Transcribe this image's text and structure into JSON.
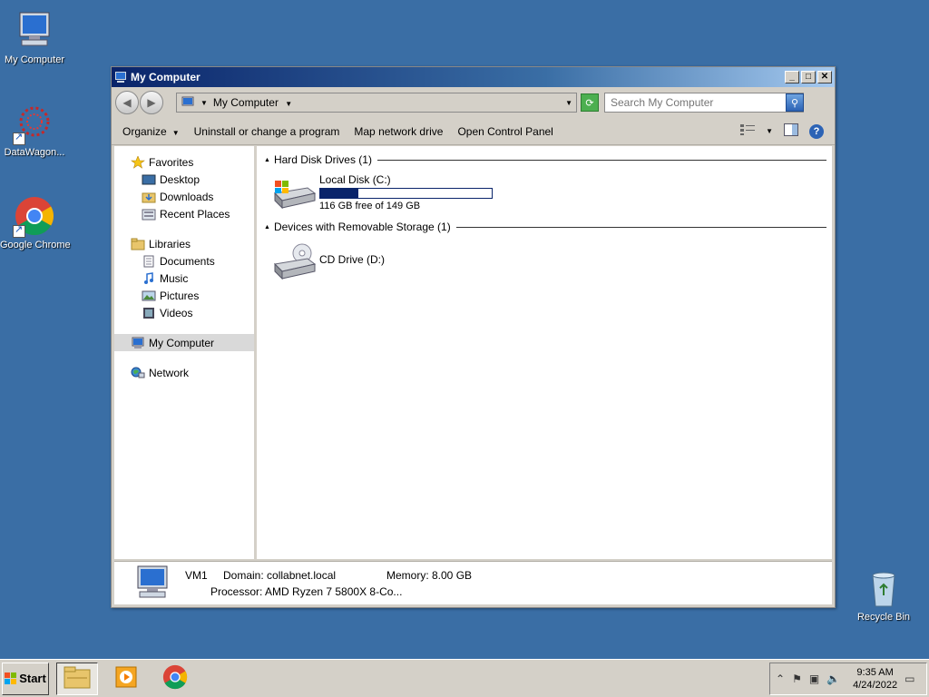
{
  "desktop": {
    "icons": [
      {
        "label": "My Computer"
      },
      {
        "label": "DataWagon..."
      },
      {
        "label": "Google Chrome"
      },
      {
        "label": "Recycle Bin"
      }
    ]
  },
  "window": {
    "title": "My Computer",
    "address": {
      "path": "My Computer"
    },
    "search": {
      "placeholder": "Search My Computer"
    },
    "toolbar": {
      "organize": "Organize",
      "uninstall": "Uninstall or change a program",
      "map_drive": "Map network drive",
      "control_panel": "Open Control Panel"
    },
    "nav": {
      "favorites": {
        "label": "Favorites",
        "items": [
          "Desktop",
          "Downloads",
          "Recent Places"
        ]
      },
      "libraries": {
        "label": "Libraries",
        "items": [
          "Documents",
          "Music",
          "Pictures",
          "Videos"
        ]
      },
      "computer": "My Computer",
      "network": "Network"
    },
    "groups": {
      "hdd": {
        "header": "Hard Disk Drives (1)",
        "drive_name": "Local Disk (C:)",
        "free_text": "116 GB free of 149 GB",
        "used_fraction": 0.22
      },
      "removable": {
        "header": "Devices with Removable Storage (1)",
        "drive_name": "CD Drive (D:)"
      }
    },
    "details": {
      "name": "VM1",
      "domain": "Domain: collabnet.local",
      "memory": "Memory: 8.00 GB",
      "processor": "Processor: AMD Ryzen 7 5800X 8-Co..."
    }
  },
  "taskbar": {
    "start_label": "Start",
    "clock": {
      "time": "9:35 AM",
      "date": "4/24/2022"
    }
  },
  "colors": {
    "desktop": "#3a6ea5",
    "accent": "#0a246a",
    "chrome_red": "#db4437",
    "chrome_green": "#0f9d58",
    "chrome_yellow": "#f4b400",
    "chrome_blue": "#4285f4"
  }
}
